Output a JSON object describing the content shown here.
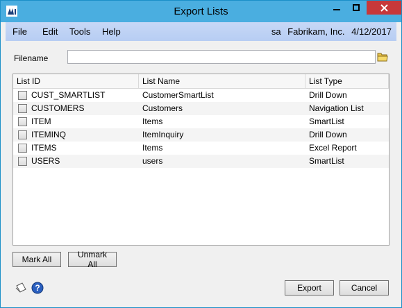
{
  "window": {
    "title": "Export Lists"
  },
  "menu": {
    "items": [
      "File",
      "Edit",
      "Tools",
      "Help"
    ],
    "user": "sa",
    "company": "Fabrikam, Inc.",
    "date": "4/12/2017"
  },
  "filename": {
    "label": "Filename",
    "value": ""
  },
  "grid": {
    "columns": [
      "List ID",
      "List Name",
      "List Type"
    ],
    "rows": [
      {
        "id": "CUST_SMARTLIST",
        "name": "CustomerSmartList",
        "type": "Drill Down",
        "checked": false
      },
      {
        "id": "CUSTOMERS",
        "name": "Customers",
        "type": "Navigation List",
        "checked": false
      },
      {
        "id": "ITEM",
        "name": "Items",
        "type": "SmartList",
        "checked": false
      },
      {
        "id": "ITEMINQ",
        "name": "ItemInquiry",
        "type": "Drill Down",
        "checked": false
      },
      {
        "id": "ITEMS",
        "name": "Items",
        "type": "Excel Report",
        "checked": false
      },
      {
        "id": "USERS",
        "name": "users",
        "type": "SmartList",
        "checked": false
      }
    ]
  },
  "buttons": {
    "mark_all": "Mark All",
    "unmark_all": "Unmark All",
    "export": "Export",
    "cancel": "Cancel"
  },
  "colors": {
    "titlebar": "#4aaee0",
    "close_button": "#c7383a",
    "menubar": "#bcd0f4"
  },
  "icons": [
    "app-icon",
    "minimize-icon",
    "maximize-icon",
    "close-icon",
    "folder-icon",
    "note-icon",
    "help-icon"
  ]
}
